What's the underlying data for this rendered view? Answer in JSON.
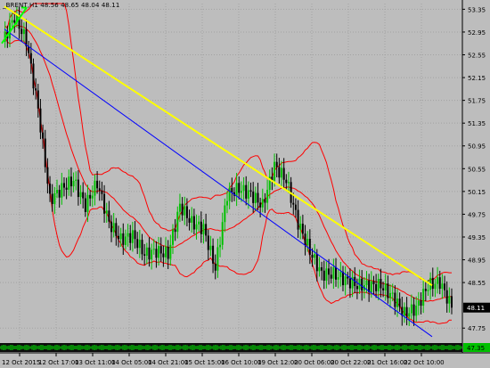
{
  "header": {
    "symbol_text": "_BRENT,H1  48.56 48.65 48.04 48.11"
  },
  "current_price": "48.11",
  "indicator_label": "47.35",
  "colors": {
    "background": "#bdbdbd",
    "bull_candle": "#00c000",
    "bear_candle": "#000000",
    "bands": "#ff0000",
    "trendline_yellow": "#ffff00",
    "trendline_blue": "#0000ff",
    "indicator": "#00ff00",
    "price_tag_bg": "#000000"
  },
  "chart_data": {
    "type": "line",
    "x_ticks": [
      "12 Oct 2015",
      "12 Oct 17:00",
      "13 Oct 11:00",
      "14 Oct 05:00",
      "14 Oct 21:00",
      "15 Oct 15:00",
      "16 Oct 10:00",
      "19 Oct 12:00",
      "20 Oct 06:00",
      "20 Oct 22:00",
      "21 Oct 16:00",
      "22 Oct 10:00"
    ],
    "y_ticks": [
      "53.35",
      "52.95",
      "52.55",
      "52.15",
      "51.75",
      "51.35",
      "50.95",
      "50.55",
      "50.15",
      "49.75",
      "49.35",
      "48.95",
      "48.55",
      "48.11",
      "47.75"
    ],
    "ylim": [
      47.55,
      53.45
    ],
    "grid": true,
    "series": [
      {
        "name": "_BRENT,H1",
        "values": [
          52.78,
          53.22,
          52.8,
          51.6,
          50.0,
          50.2,
          50.35,
          49.9,
          50.3,
          49.6,
          49.3,
          49.38,
          49.05,
          49.1,
          49.05,
          49.9,
          49.6,
          49.5,
          48.8,
          50.1,
          50.2,
          50.1,
          49.9,
          50.6,
          50.35,
          49.6,
          49.1,
          48.7,
          48.7,
          48.6,
          48.5,
          48.5,
          48.5,
          48.3,
          48.0,
          48.1,
          48.5,
          48.56,
          48.11
        ]
      }
    ],
    "trendlines": [
      {
        "color": "yellow",
        "from": {
          "x": "12 Oct 2015",
          "y": 53.4
        },
        "to": {
          "x": "22 Oct 10:00",
          "y": 48.5
        }
      },
      {
        "color": "blue",
        "from": {
          "x": "12 Oct 2015",
          "y": 53.0
        },
        "to": {
          "x": "22 Oct 10:00",
          "y": 47.6
        }
      }
    ]
  }
}
